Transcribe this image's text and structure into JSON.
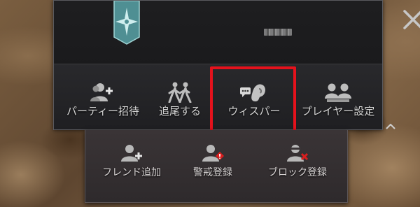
{
  "menu": {
    "actions": [
      {
        "label": "パーティー招待",
        "icon": "party-invite-icon"
      },
      {
        "label": "追尾する",
        "icon": "follow-icon"
      },
      {
        "label": "ウィスパー",
        "icon": "whisper-icon"
      },
      {
        "label": "プレイヤー設定",
        "icon": "player-settings-icon"
      }
    ],
    "sub_actions": [
      {
        "label": "フレンド追加",
        "icon": "add-friend-icon"
      },
      {
        "label": "警戒登録",
        "icon": "alert-register-icon"
      },
      {
        "label": "ブロック登録",
        "icon": "block-register-icon"
      }
    ],
    "highlight_color": "#e5121c"
  }
}
